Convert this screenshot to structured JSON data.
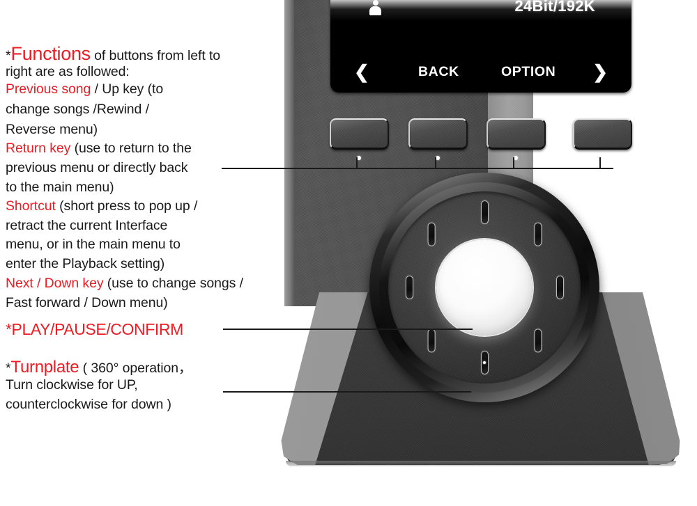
{
  "annotations": {
    "functions_heading_marker": "*",
    "functions_heading_red": "Functions",
    "functions_heading_rest": " of buttons from left to",
    "functions_heading_line2": "right are as followed:",
    "prev_red": "Previous song",
    "prev_rest": " / Up key (to",
    "prev_line2": "change songs /Rewind /",
    "prev_line3": "Reverse menu)",
    "return_red": "Return key",
    "return_rest": " (use to return to the",
    "return_line2": "previous menu or directly back",
    "return_line3": " to the main menu)",
    "shortcut_red": "Shortcut",
    "shortcut_rest": " (short press to pop up /",
    "shortcut_line2": " retract the current Interface",
    "shortcut_line3": "menu, or in the main menu to",
    "shortcut_line4": "enter the Playback setting)",
    "next_red": "Next / Down key",
    "next_rest": " (use to change songs /",
    "next_line2": "Fast forward / Down menu)",
    "play_pause": "*PLAY/PAUSE/CONFIRM",
    "turnplate_marker": "*",
    "turnplate_red": "Turnplate",
    "turnplate_rest": " ( 360° operation，",
    "turnplate_line2": "Turn  clockwise for UP,",
    "turnplate_line3": "counterclockwise for down )"
  },
  "device": {
    "screen": {
      "user_icon": "user-icon",
      "bitrate": "24Bit/192K",
      "nav_left": "❮",
      "nav_back": "BACK",
      "nav_option": "OPTION",
      "nav_right": "❯"
    },
    "buttons": [
      {
        "name": "previous-song-up-key"
      },
      {
        "name": "return-key"
      },
      {
        "name": "shortcut-key"
      },
      {
        "name": "next-down-key"
      }
    ],
    "dial": {
      "center_label": "play-pause-confirm",
      "slot_count": 8
    }
  },
  "colors": {
    "accent_red": "#ed1c24",
    "text_black": "#1a1a1a",
    "background": "#ffffff",
    "screen_background": "#000000",
    "device_body": "#4e4e4e",
    "device_base": "#333333"
  }
}
